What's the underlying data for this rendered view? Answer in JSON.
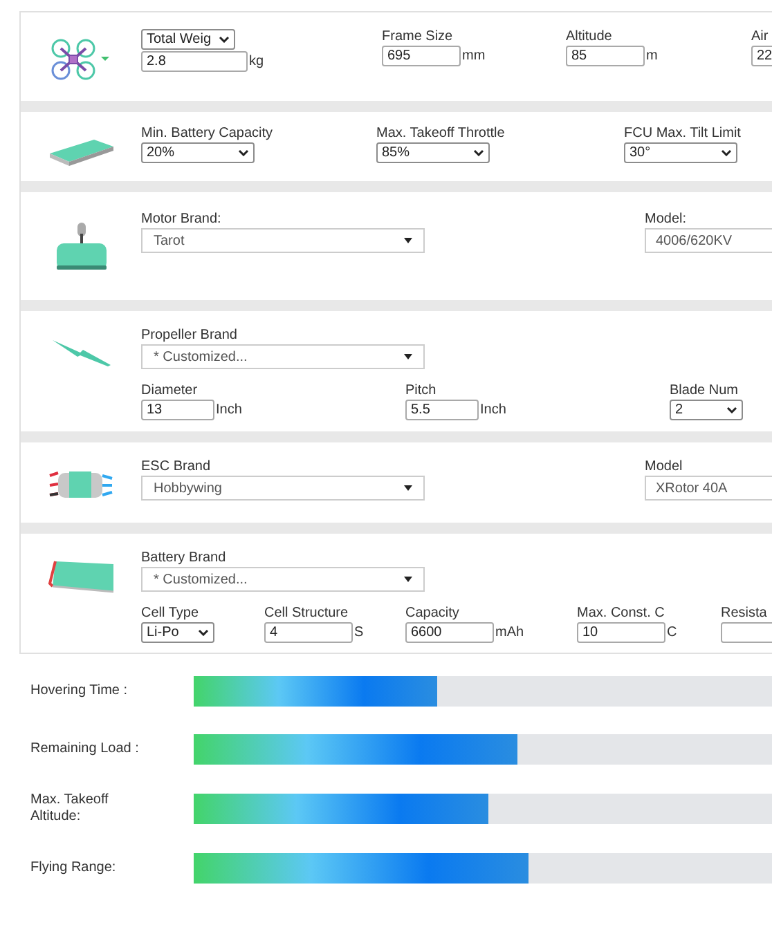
{
  "sections": [
    {
      "kind": "frame",
      "rows": [
        [
          {
            "kind": "picker-input",
            "selector": "Total Weig",
            "value": "2.8",
            "unit": "kg"
          },
          {
            "kind": "input",
            "label": "Frame Size",
            "value": "695",
            "unit": "mm"
          },
          {
            "kind": "input",
            "label": "Altitude",
            "value": "85",
            "unit": "m"
          },
          {
            "kind": "input",
            "label": "Air",
            "value": "22"
          }
        ]
      ]
    },
    {
      "kind": "battery",
      "rows": [
        [
          {
            "kind": "select",
            "label": "Min. Battery Capacity",
            "value": "20%"
          },
          {
            "kind": "select",
            "label": "Max. Takeoff Throttle",
            "value": "85%"
          },
          {
            "kind": "select",
            "label": "FCU Max. Tilt Limit",
            "value": "30°"
          }
        ]
      ]
    },
    {
      "kind": "motor",
      "rows": [
        [
          {
            "kind": "dropdown",
            "label": "Motor Brand:",
            "value": "Tarot"
          },
          {
            "kind": "readonly",
            "label": "Model:",
            "value": "4006/620KV"
          }
        ]
      ]
    },
    {
      "kind": "propeller",
      "rows": [
        [
          {
            "kind": "dropdown",
            "label": "Propeller Brand",
            "value": "* Customized..."
          }
        ],
        [
          {
            "kind": "input",
            "label": "Diameter",
            "value": "13",
            "unit": "Inch"
          },
          {
            "kind": "input",
            "label": "Pitch",
            "value": "5.5",
            "unit": "Inch"
          },
          {
            "kind": "select",
            "label": "Blade Num",
            "value": "2"
          }
        ]
      ]
    },
    {
      "kind": "esc",
      "rows": [
        [
          {
            "kind": "dropdown",
            "label": "ESC Brand",
            "value": "Hobbywing"
          },
          {
            "kind": "readonly",
            "label": "Model",
            "value": "XRotor 40A"
          }
        ]
      ]
    },
    {
      "kind": "pack",
      "rows": [
        [
          {
            "kind": "dropdown",
            "label": "Battery Brand",
            "value": "* Customized..."
          }
        ],
        [
          {
            "kind": "select",
            "label": "Cell Type",
            "value": "Li-Po"
          },
          {
            "kind": "input",
            "label": "Cell Structure",
            "value": "4",
            "unit": "S"
          },
          {
            "kind": "input",
            "label": "Capacity",
            "value": "6600",
            "unit": "mAh"
          },
          {
            "kind": "input",
            "label": "Max. Const. C",
            "value": "10",
            "unit": "C"
          },
          {
            "kind": "input",
            "label": "Resista"
          }
        ]
      ]
    }
  ],
  "results": [
    {
      "label": "Hovering Time :",
      "level": 0.42
    },
    {
      "label": "Remaining Load :",
      "level": 0.56
    },
    {
      "label": "Max. Takeoff Altitude:",
      "level": 0.51
    },
    {
      "label": "Flying Range:",
      "level": 0.58
    }
  ]
}
